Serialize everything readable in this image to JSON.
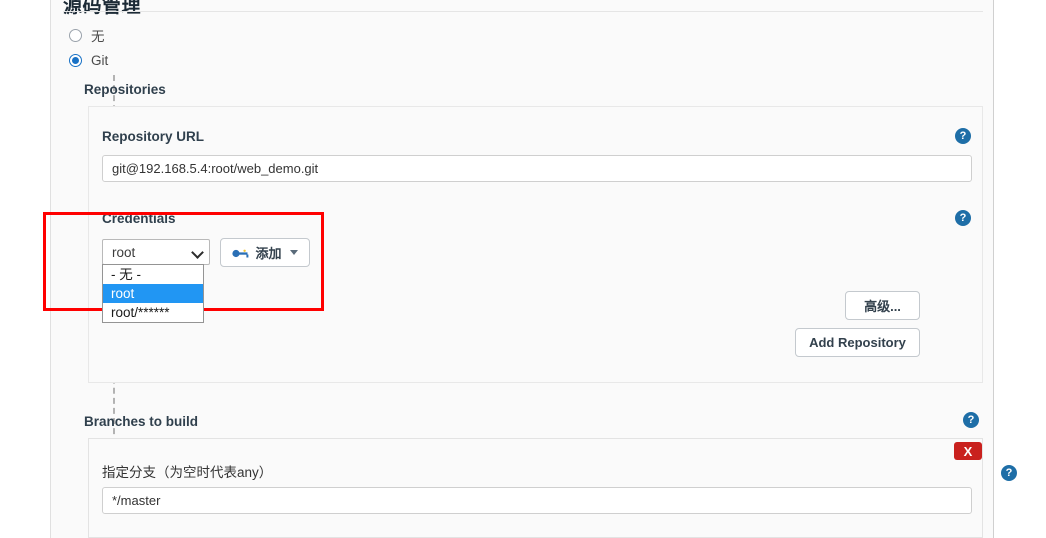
{
  "page": {
    "title": "源码管理"
  },
  "scm": {
    "options": [
      {
        "label": "无",
        "selected": false
      },
      {
        "label": "Git",
        "selected": true
      }
    ],
    "repositories_label": "Repositories",
    "branches_label": "Branches to build"
  },
  "repository": {
    "url_label": "Repository URL",
    "url_value": "git@192.168.5.4:root/web_demo.git",
    "credentials_label": "Credentials",
    "credentials_selected": "root",
    "credentials_options": [
      {
        "label": "- 无 -",
        "highlighted": false
      },
      {
        "label": "root",
        "highlighted": true
      },
      {
        "label": "root/******",
        "highlighted": false
      }
    ],
    "add_button_label": "添加",
    "advanced_button_label": "高级...",
    "add_repository_button_label": "Add Repository"
  },
  "branches": {
    "branch_label": "指定分支（为空时代表any）",
    "branch_value": "*/master",
    "delete_label": "X"
  },
  "icons": {
    "help": "?",
    "key": "key-icon",
    "chevron_down": "chevron-down-icon"
  },
  "colors": {
    "accent_blue": "#1871c5",
    "help_blue": "#1e6ea7",
    "highlight_blue": "#2196f3",
    "danger_red": "#c9211e",
    "annotation_red": "#ff0000"
  }
}
